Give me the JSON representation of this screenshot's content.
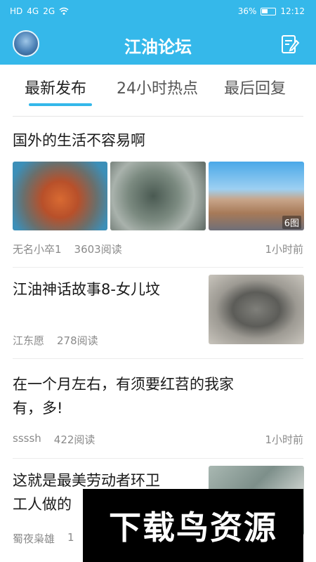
{
  "status_bar": {
    "network": "HD",
    "signal1": "4G",
    "signal2": "2G",
    "battery": "36%",
    "time": "12:12"
  },
  "header": {
    "title": "江油论坛"
  },
  "tabs": [
    {
      "label": "最新发布",
      "active": true
    },
    {
      "label": "24小时热点",
      "active": false
    },
    {
      "label": "最后回复",
      "active": false
    }
  ],
  "posts": [
    {
      "title": "国外的生活不容易啊",
      "author": "无名小卒1",
      "reads": "3603阅读",
      "time": "1小时前",
      "image_count": "6图"
    },
    {
      "title": "江油神话故事8-女儿坟",
      "author": "江东愿",
      "reads": "278阅读",
      "time": ""
    },
    {
      "title_line1": "在一个月左右，有须要红苕的我家",
      "title_line2": "有，多!",
      "author": "ssssh",
      "reads": "422阅读",
      "time": "1小时前"
    },
    {
      "title_line1": "这就是最美劳动者环卫",
      "title_line2": "工人做的",
      "author": "蜀夜枭雄",
      "reads": "1"
    }
  ],
  "watermark": {
    "text": "下载鸟资源"
  },
  "colors": {
    "accent": "#35b8ea"
  }
}
